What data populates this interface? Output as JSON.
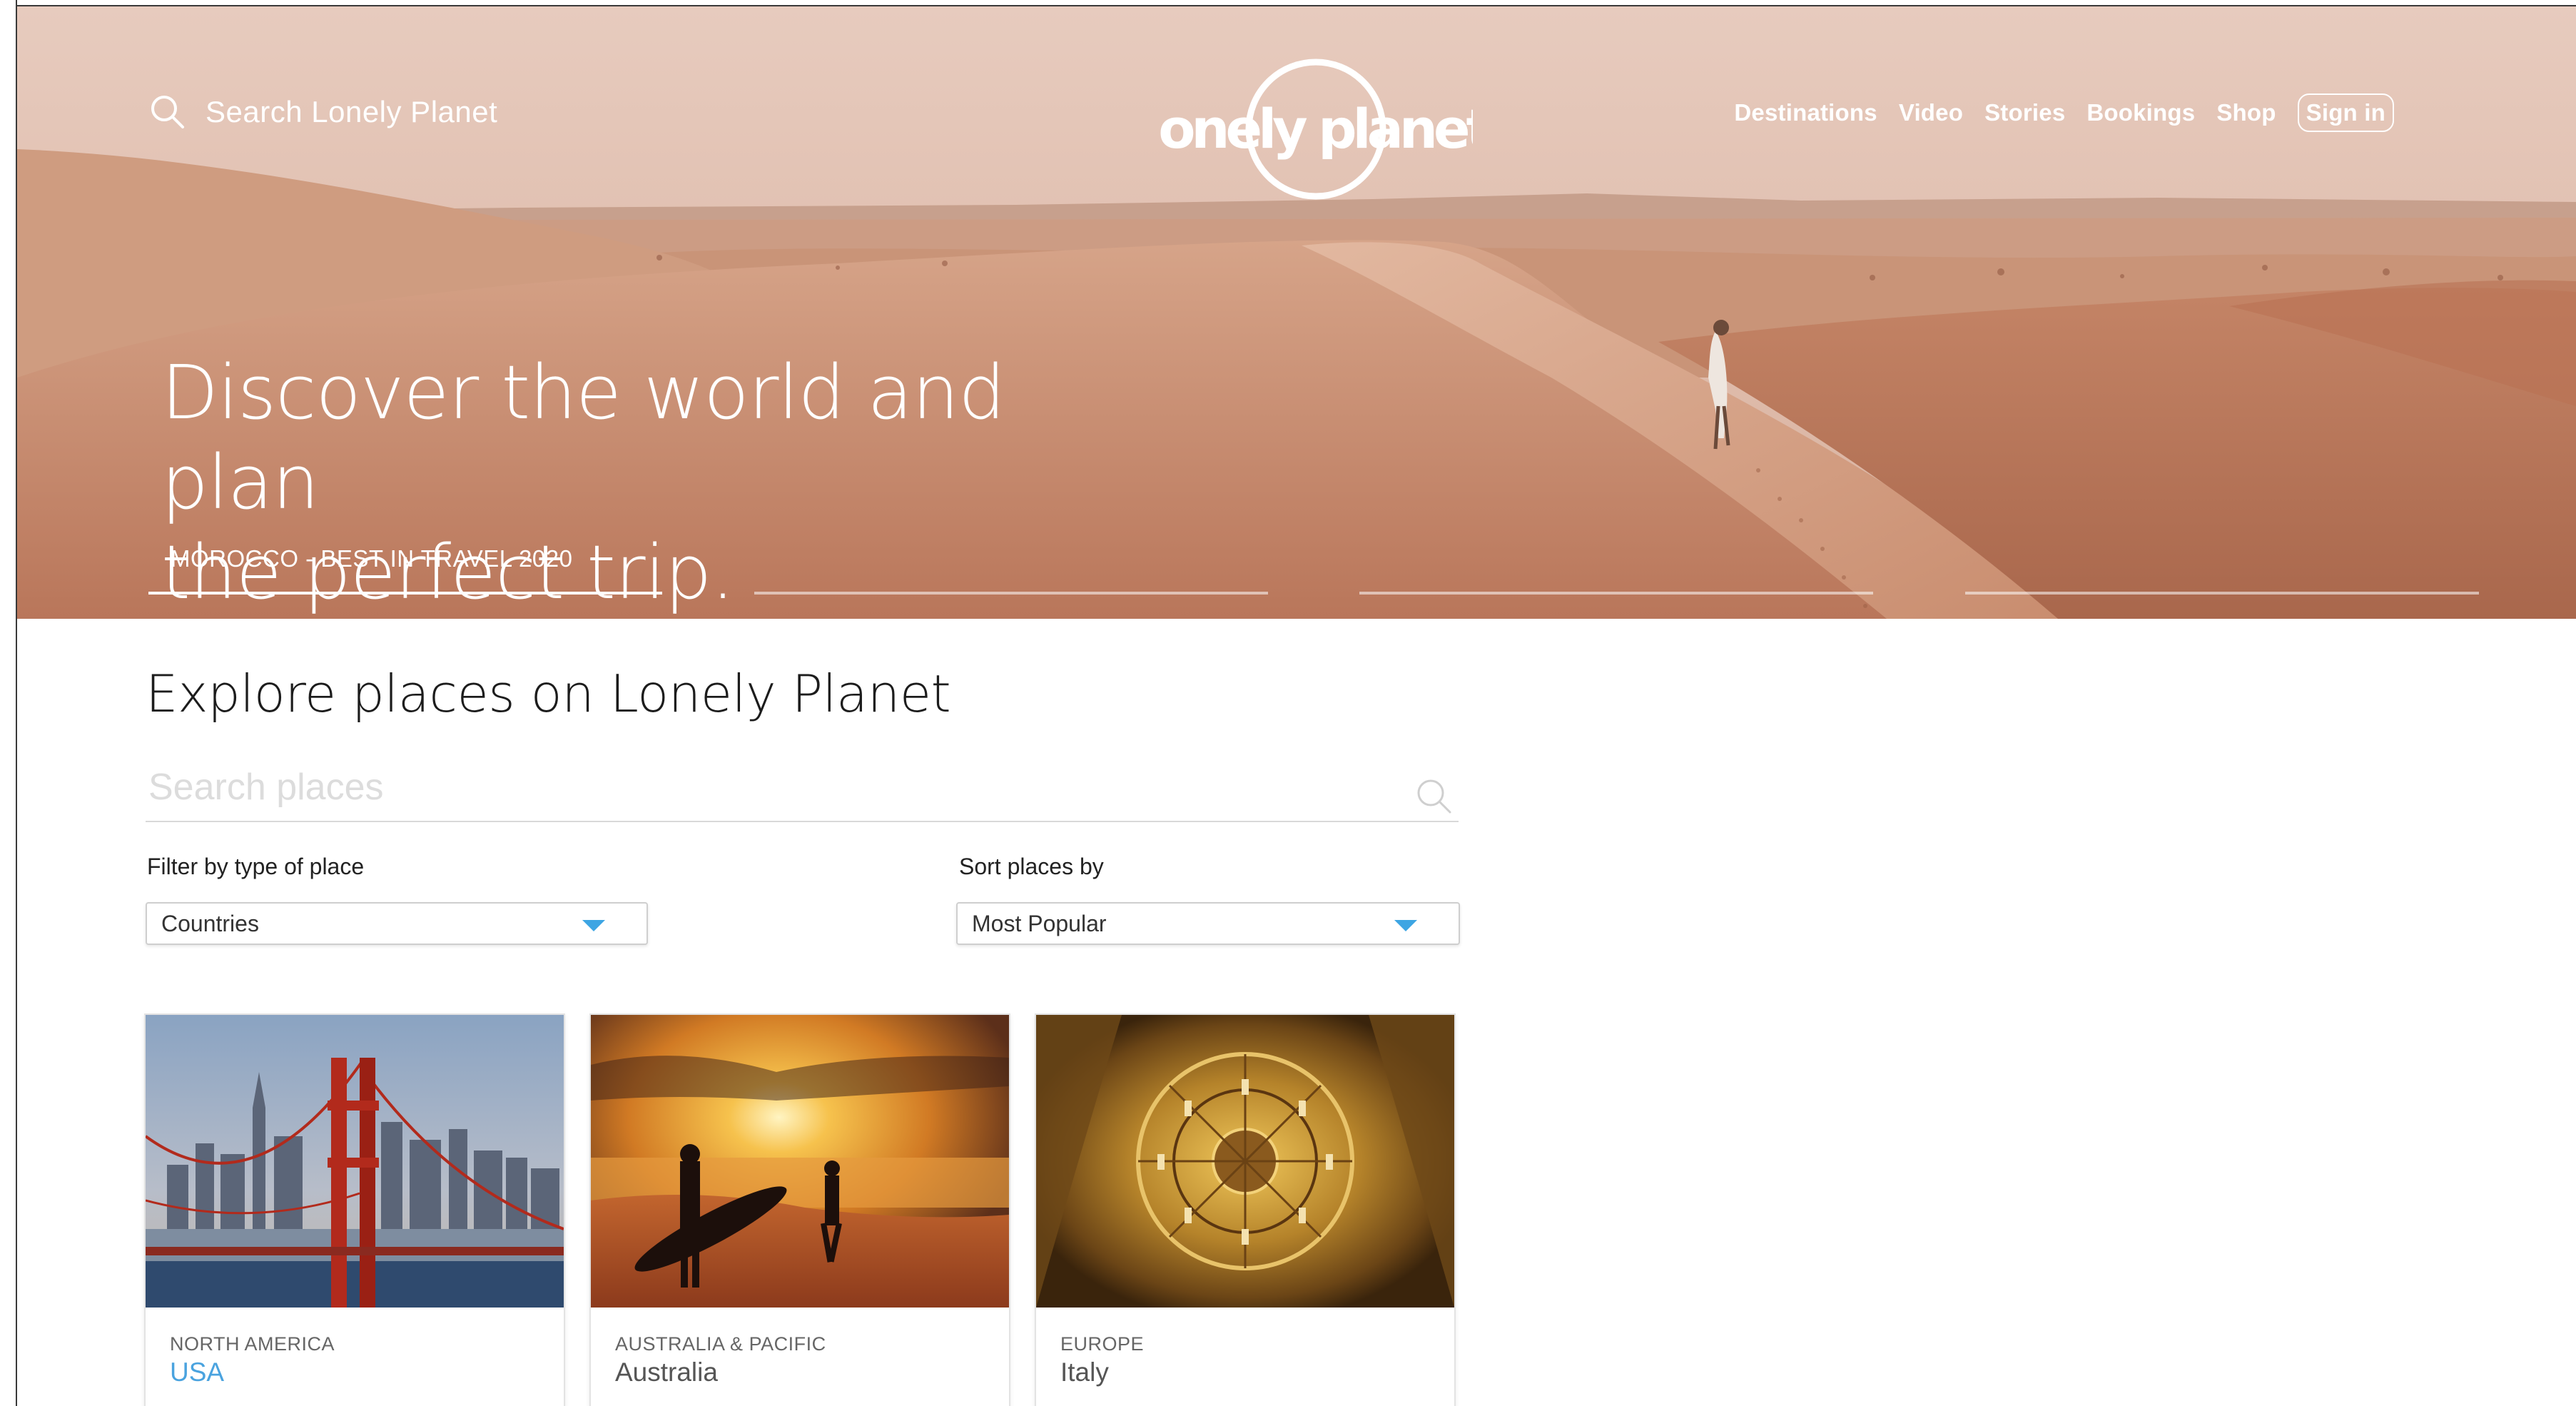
{
  "header": {
    "search_label": "Search Lonely Planet",
    "logo_text": "lonely planet",
    "nav": [
      {
        "label": "Destinations"
      },
      {
        "label": "Video"
      },
      {
        "label": "Stories"
      },
      {
        "label": "Bookings"
      },
      {
        "label": "Shop"
      }
    ],
    "sign_in": "Sign in"
  },
  "hero": {
    "title_line1": "Discover the world and plan",
    "title_line2": "the perfect trip.",
    "caption": "MOROCCO - BEST IN TRAVEL 2020",
    "slides_count": 4,
    "active_slide": 1
  },
  "explore": {
    "title": "Explore places on Lonely Planet",
    "search_placeholder": "Search places",
    "filter_label": "Filter by type of place",
    "filter_value": "Countries",
    "sort_label": "Sort places by",
    "sort_value": "Most Popular"
  },
  "cards": [
    {
      "region": "NORTH AMERICA",
      "place": "USA",
      "image": "golden-gate-bridge"
    },
    {
      "region": "AUSTRALIA & PACIFIC",
      "place": "Australia",
      "image": "surfer-sunset-beach"
    },
    {
      "region": "EUROPE",
      "place": "Italy",
      "image": "mosaic-dome"
    }
  ],
  "colors": {
    "accent_link": "#4aa3df",
    "select_caret": "#3da5e3",
    "hero_tone": "#c58f74"
  }
}
